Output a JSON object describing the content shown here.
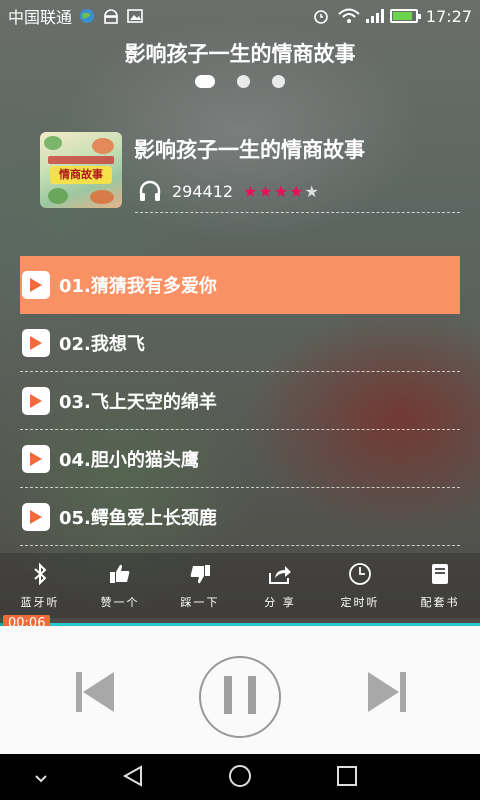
{
  "status_bar": {
    "carrier": "中国联通",
    "time": "17:27",
    "icons": [
      "globe-icon",
      "android-icon",
      "image-icon",
      "alarm-icon",
      "wifi-icon",
      "signal-icon",
      "battery-icon"
    ]
  },
  "header": {
    "title": "影响孩子一生的情商故事",
    "page_dots": 3,
    "active_dot": 0
  },
  "album": {
    "title": "影响孩子一生的情商故事",
    "cover_text": "情商故事",
    "play_count": "294412",
    "rating": 4,
    "rating_max": 5
  },
  "tracks": [
    {
      "label": "01.猜猜我有多爱你",
      "active": true
    },
    {
      "label": "02.我想飞",
      "active": false
    },
    {
      "label": "03.飞上天空的绵羊",
      "active": false
    },
    {
      "label": "04.胆小的猫头鹰",
      "active": false
    },
    {
      "label": "05.鳄鱼爱上长颈鹿",
      "active": false
    }
  ],
  "actions": [
    {
      "label": "蓝牙听",
      "icon": "bluetooth-icon"
    },
    {
      "label": "赞一个",
      "icon": "thumbs-up-icon"
    },
    {
      "label": "踩一下",
      "icon": "thumbs-down-icon"
    },
    {
      "label": "分 享",
      "icon": "share-icon"
    },
    {
      "label": "定时听",
      "icon": "clock-icon"
    },
    {
      "label": "配套书",
      "icon": "book-icon"
    }
  ],
  "player": {
    "current_time": "00:06",
    "progress": 0.02
  },
  "colors": {
    "accent": "#fa9165",
    "time_badge": "#f06a3a",
    "progress": "#2bc7cf",
    "star_on": "#e8115a"
  }
}
